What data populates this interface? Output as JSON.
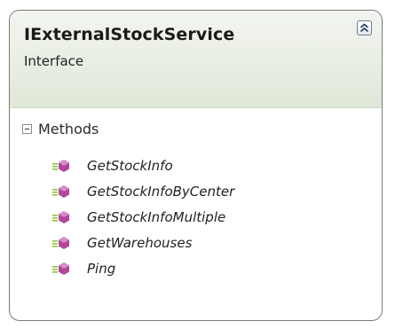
{
  "class_box": {
    "name": "IExternalStockService",
    "kind": "Interface",
    "collapse_icon": "chevron-double-up-icon"
  },
  "section": {
    "label": "Methods",
    "toggle_icon": "minus-box-icon"
  },
  "methods": [
    {
      "name": "GetStockInfo",
      "icon": "method-icon"
    },
    {
      "name": "GetStockInfoByCenter",
      "icon": "method-icon"
    },
    {
      "name": "GetStockInfoMultiple",
      "icon": "method-icon"
    },
    {
      "name": "GetWarehouses",
      "icon": "method-icon"
    },
    {
      "name": "Ping",
      "icon": "method-icon"
    }
  ],
  "colors": {
    "header_gradient_top": "#f2f5f0",
    "header_gradient_bottom": "#dfe7d7",
    "method_icon": "#b0479a",
    "method_icon_lines": "#8dc33b",
    "border": "#7a7a7a"
  }
}
